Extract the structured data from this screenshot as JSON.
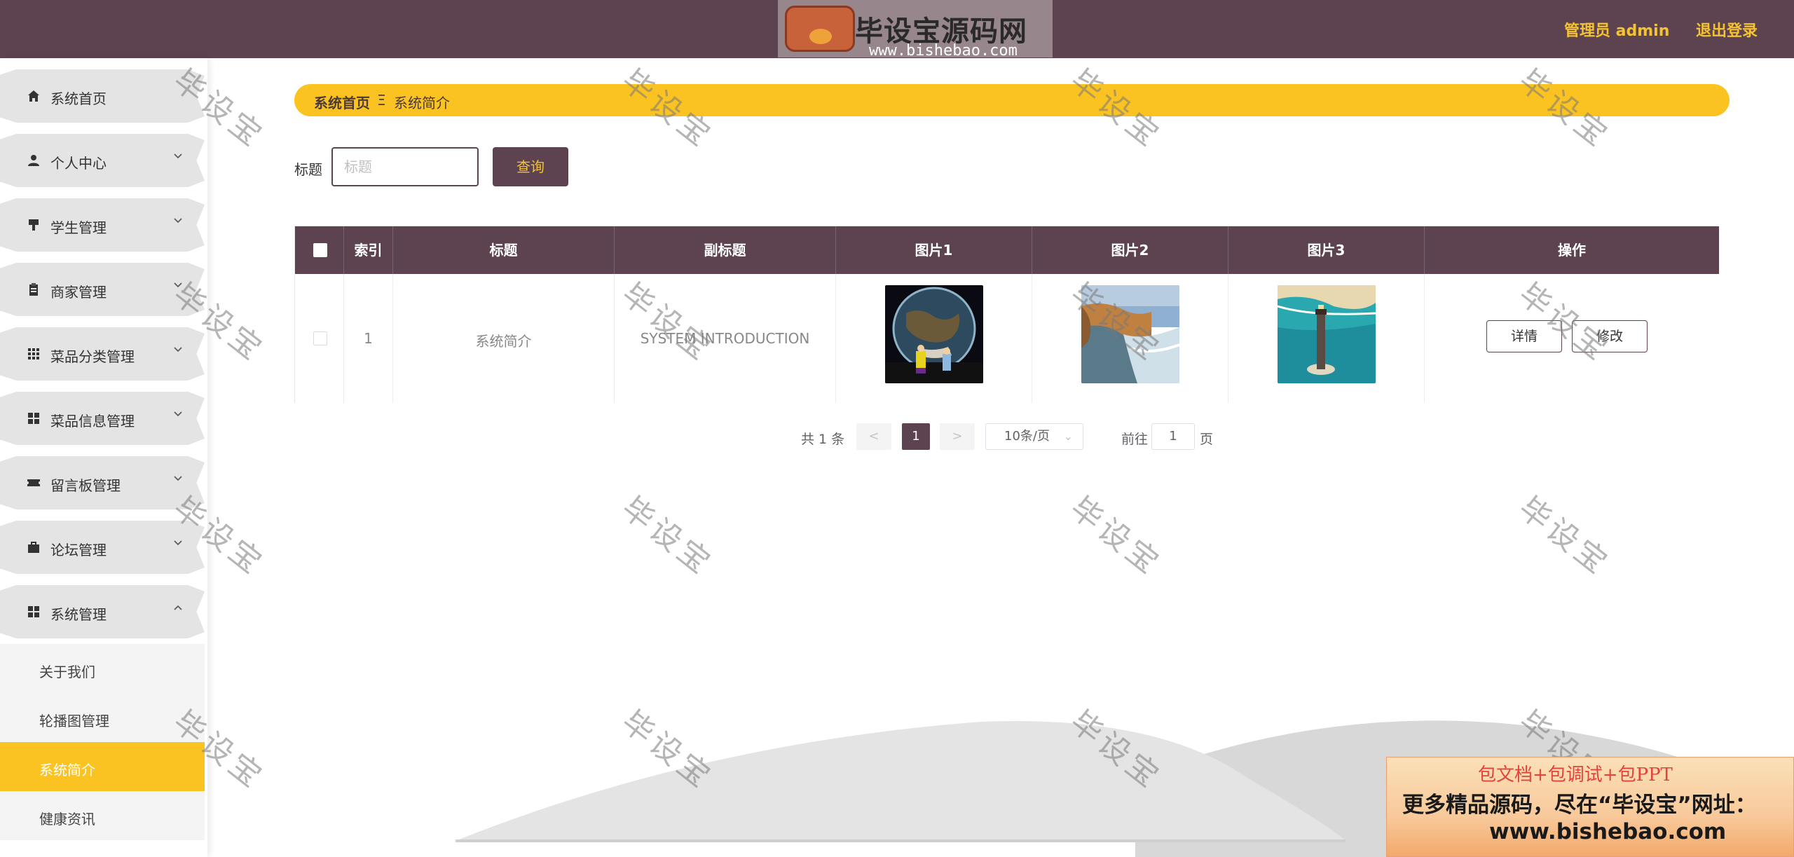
{
  "header": {
    "logo_text": "毕设宝源码网",
    "logo_url": "www.bishebao.com",
    "user": "管理员 admin",
    "logout": "退出登录"
  },
  "sidebar": {
    "items": [
      {
        "label": "系统首页",
        "icon": "home-icon",
        "glyph": "⌂",
        "expandable": false
      },
      {
        "label": "个人中心",
        "icon": "user-icon",
        "glyph": "●",
        "expandable": true
      },
      {
        "label": "学生管理",
        "icon": "student-icon",
        "glyph": "▼",
        "expandable": true
      },
      {
        "label": "商家管理",
        "icon": "clipboard-icon",
        "glyph": "▤",
        "expandable": true
      },
      {
        "label": "菜品分类管理",
        "icon": "grid-icon",
        "glyph": "▦",
        "expandable": true
      },
      {
        "label": "菜品信息管理",
        "icon": "apps-icon",
        "glyph": "▦",
        "expandable": true
      },
      {
        "label": "留言板管理",
        "icon": "ticket-icon",
        "glyph": "✉",
        "expandable": true
      },
      {
        "label": "论坛管理",
        "icon": "briefcase-icon",
        "glyph": "▣",
        "expandable": true
      },
      {
        "label": "系统管理",
        "icon": "apps-icon",
        "glyph": "▦",
        "expandable": true,
        "expanded": true
      }
    ],
    "sub_items": [
      {
        "label": "关于我们",
        "active": false
      },
      {
        "label": "轮播图管理",
        "active": false
      },
      {
        "label": "系统简介",
        "active": true
      },
      {
        "label": "健康资讯",
        "active": false
      }
    ]
  },
  "breadcrumb": {
    "home": "系统首页",
    "separator": "Ξ",
    "current": "系统简介"
  },
  "search": {
    "label": "标题",
    "placeholder": "标题",
    "value": "",
    "button": "查询"
  },
  "table": {
    "columns": [
      "索引",
      "标题",
      "副标题",
      "图片1",
      "图片2",
      "图片3",
      "操作"
    ],
    "rows": [
      {
        "index": "1",
        "title": "系统简介",
        "subtitle": "SYSTEM INTRODUCTION",
        "images": [
          "earth-image",
          "coast-image",
          "lighthouse-image"
        ],
        "actions": {
          "detail": "详情",
          "edit": "修改"
        }
      }
    ]
  },
  "pagination": {
    "total": "共 1 条",
    "prev": "<",
    "current_page": "1",
    "next": ">",
    "page_size": "10条/页",
    "goto_label": "前往",
    "goto_value": "1",
    "goto_unit": "页"
  },
  "watermark": "毕设宝",
  "ad": {
    "line1": "包文档+包调试+包PPT",
    "line2": "更多精品源码，尽在“毕设宝”网址：",
    "line3": "www.bishebao.com"
  },
  "colors": {
    "primary": "#5c434f",
    "accent": "#fbc321",
    "header_text": "#f4c332"
  }
}
